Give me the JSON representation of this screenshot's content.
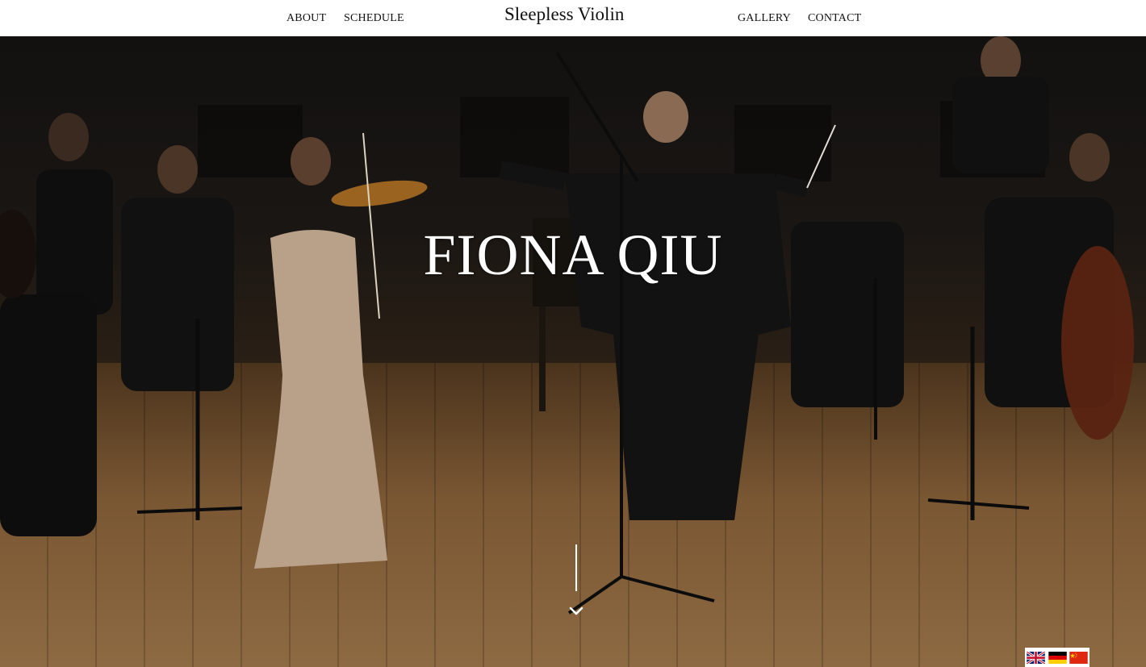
{
  "nav": {
    "about": "ABOUT",
    "schedule": "SCHEDULE",
    "brand": "Sleepless Violin",
    "gallery": "GALLERY",
    "contact": "CONTACT"
  },
  "hero": {
    "title": "FIONA QIU",
    "scroll_icon": "chevron-down-icon"
  },
  "languages": [
    {
      "icon": "uk-flag-icon"
    },
    {
      "icon": "german-flag-icon"
    },
    {
      "icon": "chinese-flag-icon"
    }
  ],
  "colors": {
    "nav_text": "#111111",
    "hero_text": "#ffffff",
    "stage_wood": "#7a5733",
    "dress": "#b9a089"
  }
}
